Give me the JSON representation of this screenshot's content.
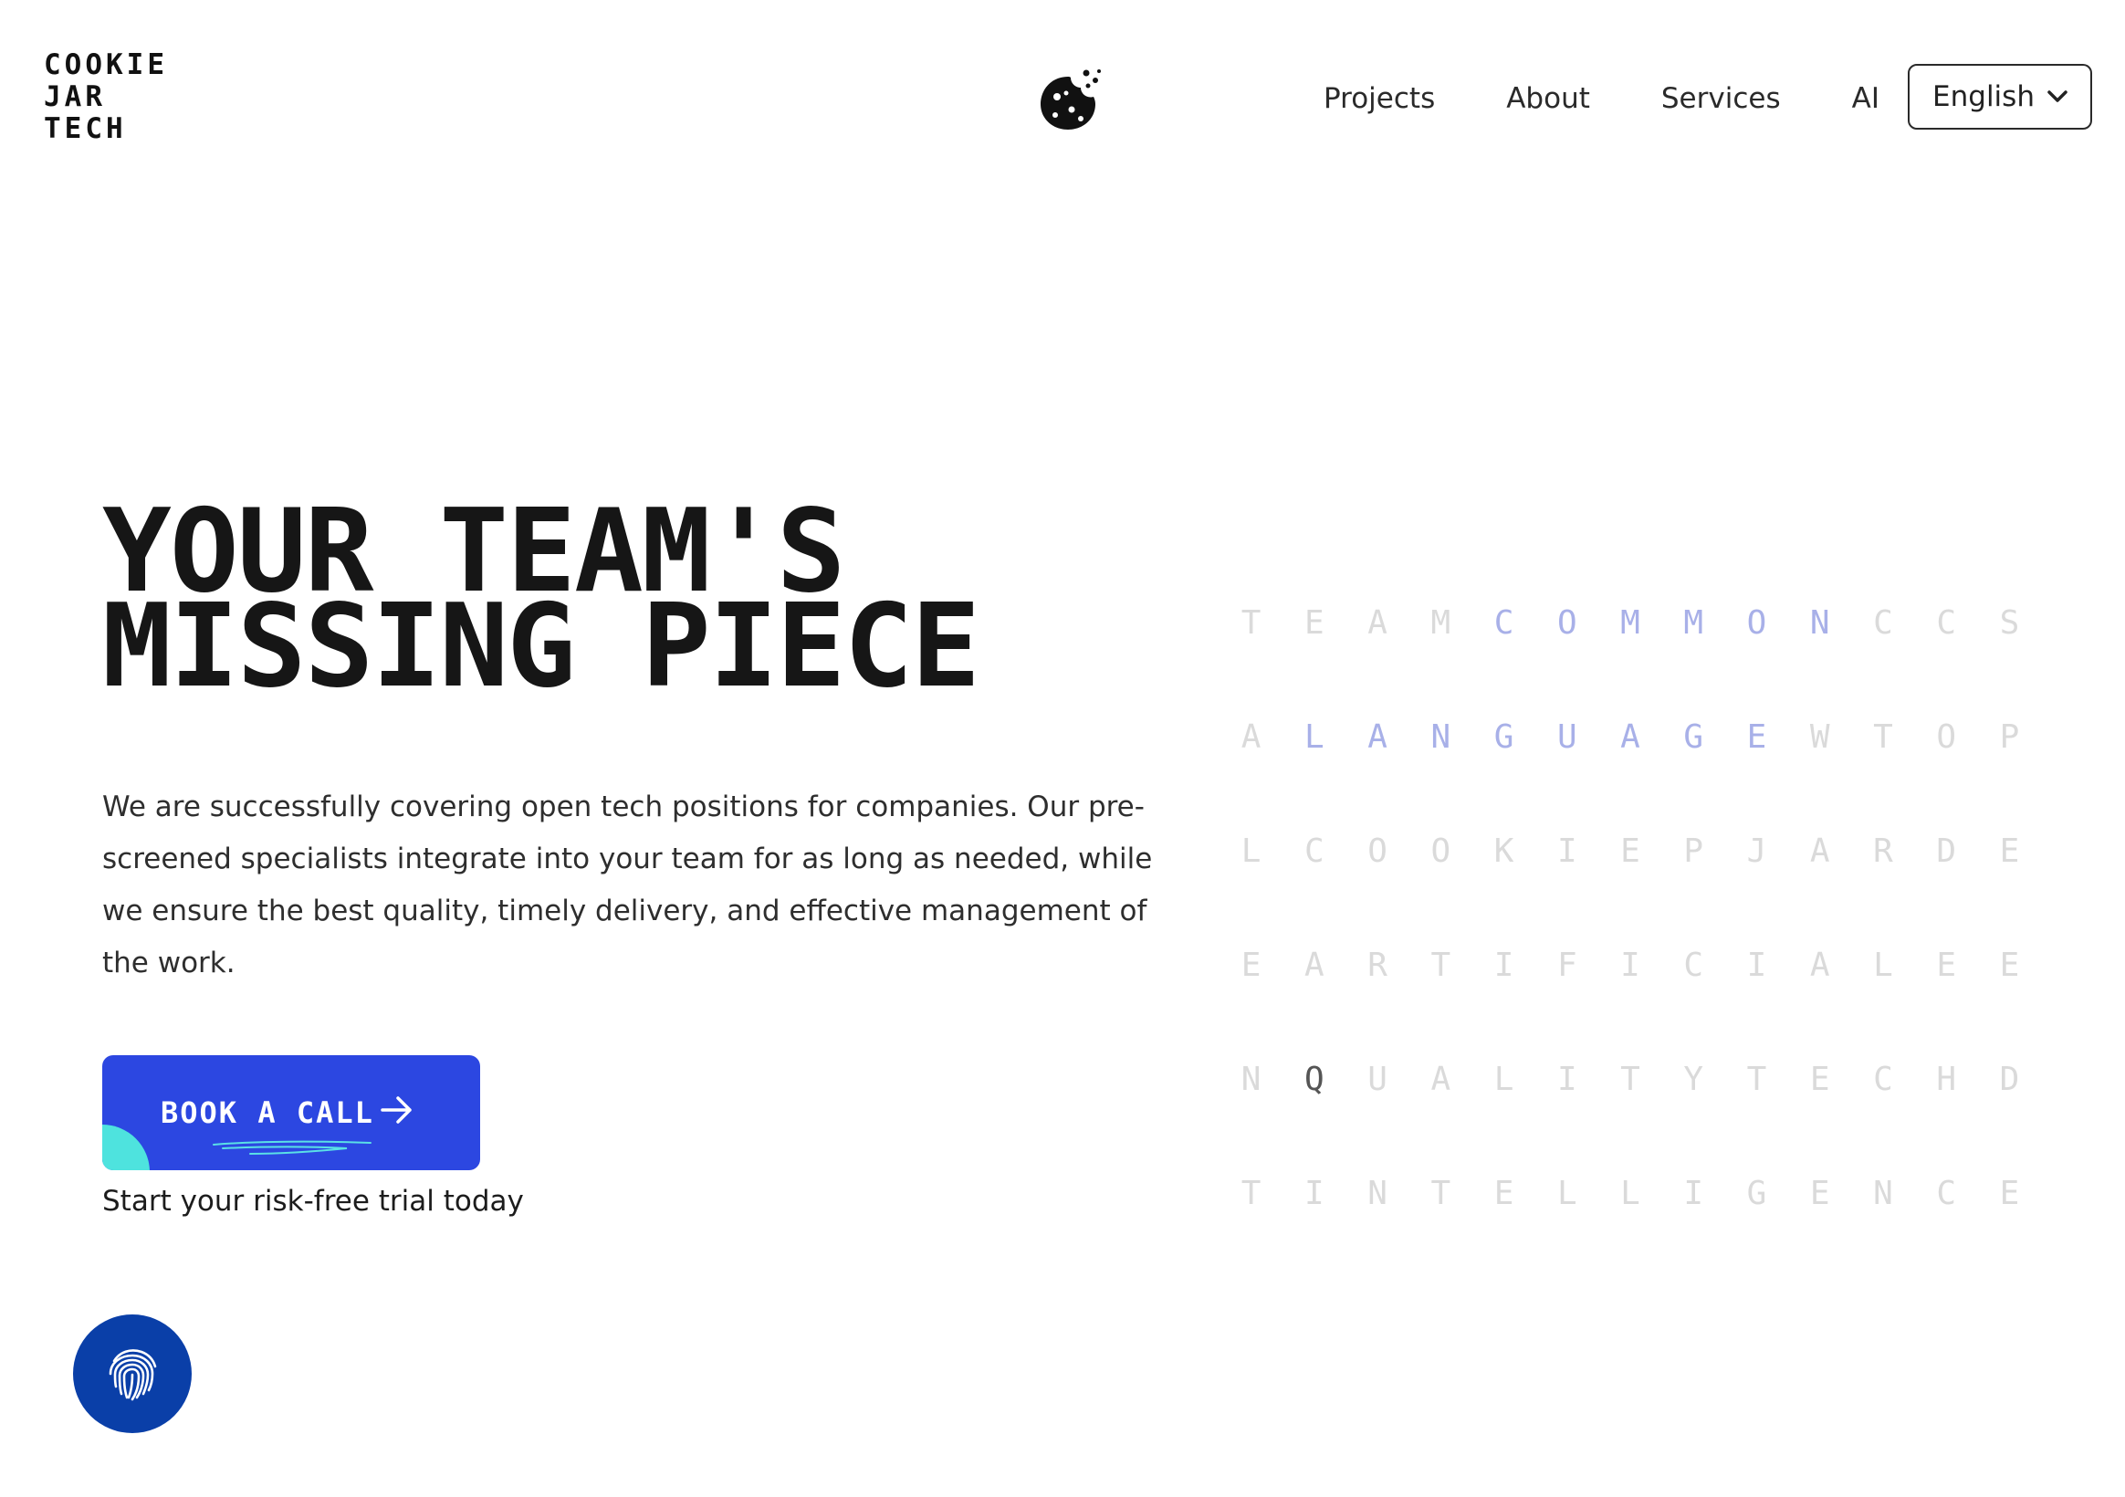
{
  "header": {
    "logo_lines": [
      "COOKIE",
      "JAR",
      "TECH"
    ],
    "nav": [
      "Projects",
      "About",
      "Services",
      "AI"
    ],
    "language": "English"
  },
  "hero": {
    "title_lines": [
      "YOUR TEAM'S",
      "MISSING PIECE"
    ],
    "description": "We are successfully covering open tech positions for companies. Our pre-screened specialists integrate into your team for as long as needed, while we ensure the best quality, timely delivery, and effective management of the work.",
    "cta_label": "BOOK A CALL",
    "cta_subtitle": "Start your risk-free trial today"
  },
  "letter_grid": {
    "rows": [
      [
        "T",
        "E",
        "A",
        "M",
        "C",
        "O",
        "M",
        "M",
        "O",
        "N",
        "C",
        "C",
        "S"
      ],
      [
        "A",
        "L",
        "A",
        "N",
        "G",
        "U",
        "A",
        "G",
        "E",
        "W",
        "T",
        "O",
        "P"
      ],
      [
        "L",
        "C",
        "O",
        "O",
        "K",
        "I",
        "E",
        "P",
        "J",
        "A",
        "R",
        "D",
        "E"
      ],
      [
        "E",
        "A",
        "R",
        "T",
        "I",
        "F",
        "I",
        "C",
        "I",
        "A",
        "L",
        "E",
        "E"
      ],
      [
        "N",
        "Q",
        "U",
        "A",
        "L",
        "I",
        "T",
        "Y",
        "T",
        "E",
        "C",
        "H",
        "D"
      ],
      [
        "T",
        "I",
        "N",
        "T",
        "E",
        "L",
        "L",
        "I",
        "G",
        "E",
        "N",
        "C",
        "E"
      ]
    ],
    "highlights": {
      "0": [
        4,
        5,
        6,
        7,
        8,
        9
      ],
      "1": [
        1,
        2,
        3,
        4,
        5,
        6,
        7,
        8
      ]
    },
    "dark": {
      "4": [
        1
      ]
    },
    "colors": {
      "default": "#dadada",
      "highlight": "#a8b0e8",
      "dark": "#555555"
    }
  },
  "colors": {
    "cta": "#2c47e1",
    "cta_accent": "#4ee3de",
    "fab": "#0a3fa8"
  },
  "icons": {
    "logo_mark": "cookie-icon",
    "lang_toggle": "chevron-down-icon",
    "cta": "arrow-right-icon",
    "fab": "fingerprint-icon"
  }
}
